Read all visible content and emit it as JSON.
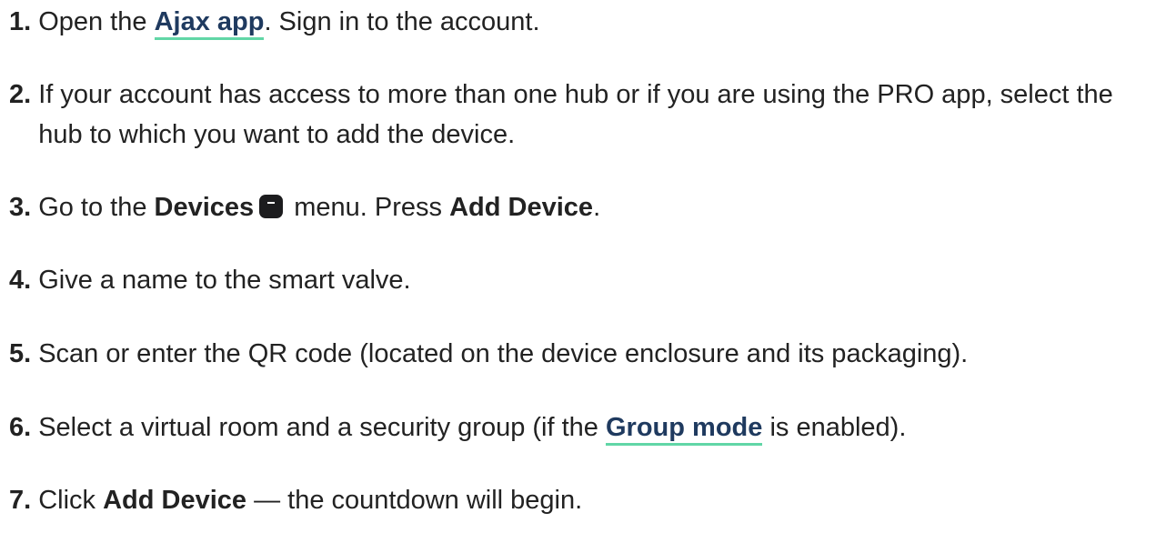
{
  "steps": [
    {
      "num": "1.",
      "pre": "Open the ",
      "link": "Ajax app",
      "post": ". Sign in to the account."
    },
    {
      "num": "2.",
      "text": "If your account has access to more than one hub or if you are using the PRO app, select the hub to which you want to add the device."
    },
    {
      "num": "3.",
      "pre": "Go to the ",
      "bold1": "Devices",
      "icon": "devices-icon",
      "mid": " menu. Press ",
      "bold2": "Add Device",
      "post": "."
    },
    {
      "num": "4.",
      "text": "Give a name to the smart valve."
    },
    {
      "num": "5.",
      "text": "Scan or enter the QR code (located on the device enclosure and its packaging)."
    },
    {
      "num": "6.",
      "pre": "Select a virtual room and a security group (if the ",
      "link": "Group mode",
      "post": " is enabled)."
    },
    {
      "num": "7.",
      "pre": "Click ",
      "bold1": "Add Device",
      "post": " — the countdown will begin."
    }
  ],
  "colors": {
    "text": "#222222",
    "link": "#1f3a5f",
    "link_underline": "#61d6a6",
    "icon": "#1c1c1e"
  }
}
